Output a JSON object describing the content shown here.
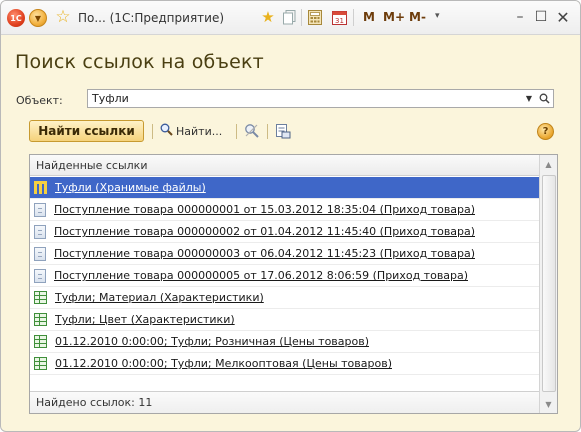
{
  "window": {
    "title": "По...  (1С:Предприятие)",
    "logo_text": "1С",
    "toolbar_m_labels": [
      "M",
      "M+",
      "M-"
    ]
  },
  "form": {
    "title": "Поиск ссылок на объект",
    "object_label": "Объект:",
    "object_value": "Туфли"
  },
  "toolbar": {
    "find_links_label": "Найти ссылки",
    "find_label": "Найти...",
    "help_symbol": "?"
  },
  "table": {
    "header": "Найденные ссылки",
    "rows": [
      {
        "icon": "register-icon",
        "text": "Туфли (Хранимые файлы)",
        "selected": true
      },
      {
        "icon": "document-icon",
        "text": "Поступление товара 000000001 от 15.03.2012 18:35:04 (Приход товара)"
      },
      {
        "icon": "document-icon",
        "text": "Поступление товара 000000002 от 01.04.2012 11:45:40 (Приход товара)"
      },
      {
        "icon": "document-icon",
        "text": "Поступление товара 000000003 от 06.04.2012 11:45:23 (Приход товара)"
      },
      {
        "icon": "document-icon",
        "text": "Поступление товара 000000005 от 17.06.2012 8:06:59 (Приход товара)"
      },
      {
        "icon": "catalog-icon",
        "text": "Туфли; Материал (Характеристики)"
      },
      {
        "icon": "catalog-icon",
        "text": "Туфли; Цвет (Характеристики)"
      },
      {
        "icon": "catalog-icon",
        "text": "01.12.2010 0:00:00; Туфли; Розничная (Цены товаров)"
      },
      {
        "icon": "catalog-icon",
        "text": "01.12.2010 0:00:00; Туфли; Мелкооптовая (Цены товаров)"
      }
    ],
    "footer": "Найдено ссылок: 11"
  },
  "colors": {
    "form_background": "#fbf5dc",
    "selection": "#3f67c8",
    "accent_button": "#f5d27b"
  }
}
